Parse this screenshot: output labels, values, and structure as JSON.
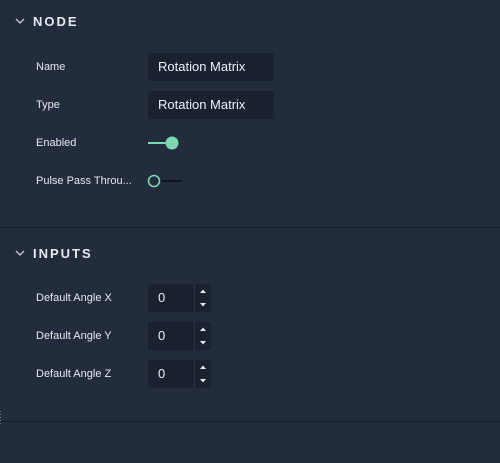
{
  "node_section": {
    "title": "NODE",
    "name_label": "Name",
    "name_value": "Rotation Matrix",
    "type_label": "Type",
    "type_value": "Rotation Matrix",
    "enabled_label": "Enabled",
    "enabled_on": true,
    "pulse_label": "Pulse Pass Throu...",
    "pulse_on": false
  },
  "inputs_section": {
    "title": "INPUTS",
    "fields": [
      {
        "label": "Default Angle X",
        "value": "0"
      },
      {
        "label": "Default Angle Y",
        "value": "0"
      },
      {
        "label": "Default Angle Z",
        "value": "0"
      }
    ]
  },
  "colors": {
    "background": "#222c3c",
    "field_bg": "#1a2230",
    "accent": "#7dd8b0"
  },
  "icons": {
    "collapse": "chevron-down-icon",
    "step_up": "caret-up-icon",
    "step_down": "caret-down-icon"
  }
}
